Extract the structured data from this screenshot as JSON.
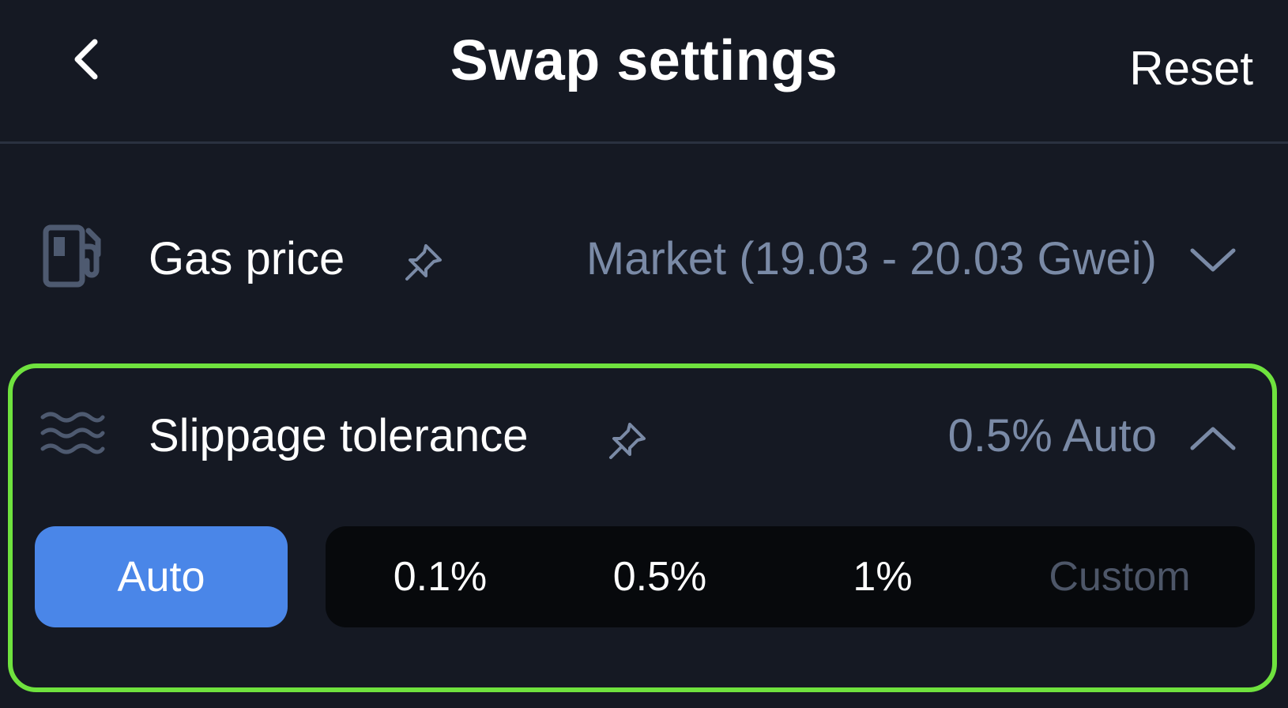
{
  "header": {
    "title": "Swap settings",
    "reset_label": "Reset",
    "back_icon": "chevron-left-icon"
  },
  "gas": {
    "label": "Gas price",
    "value": "Market (19.03 - 20.03 Gwei)",
    "icon": "gas-pump-icon",
    "expanded": false
  },
  "slippage": {
    "label": "Slippage tolerance",
    "value": "0.5% Auto",
    "icon": "waves-icon",
    "expanded": true,
    "auto_label": "Auto",
    "options": [
      "0.1%",
      "0.5%",
      "1%"
    ],
    "custom_placeholder": "Custom"
  },
  "colors": {
    "background": "#151923",
    "accent_blue": "#4a86e8",
    "highlight_green": "#6fe23e",
    "muted_text": "#7a8aa6"
  }
}
